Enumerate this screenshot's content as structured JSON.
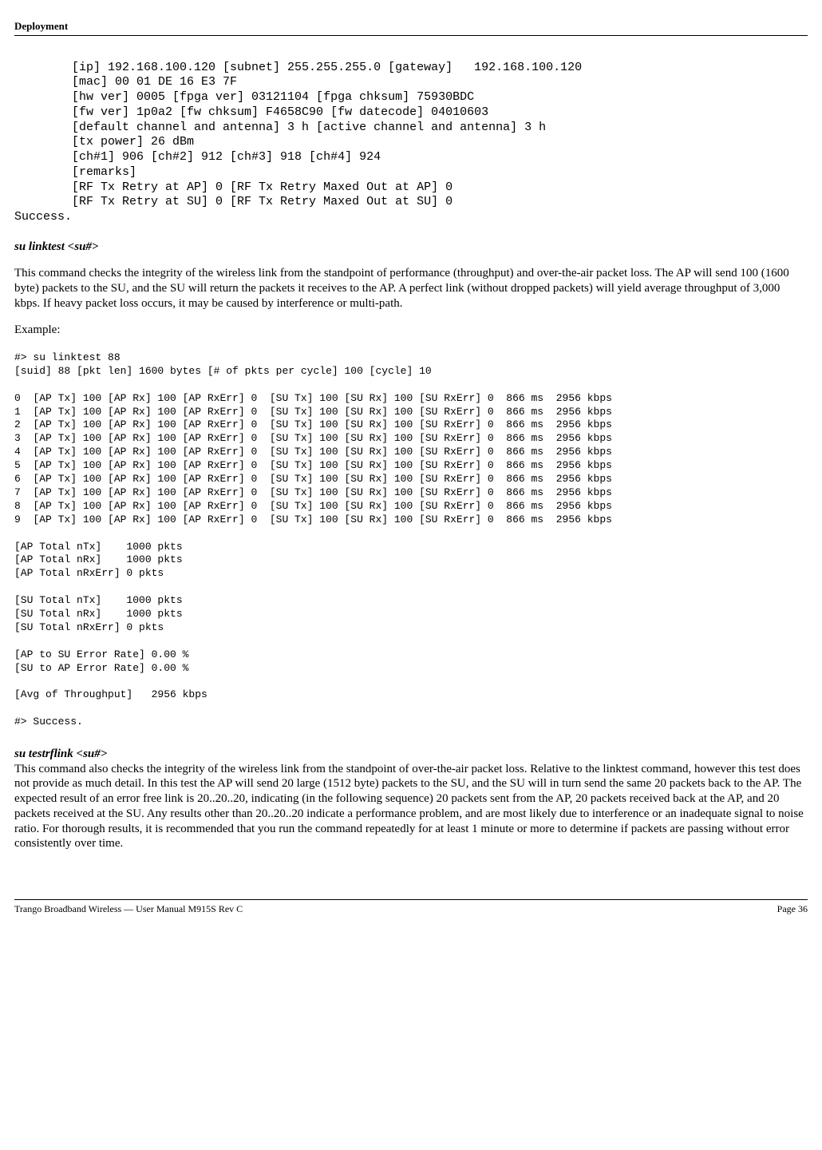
{
  "header": {
    "title": "Deployment"
  },
  "block1": {
    "l1": "        [ip] 192.168.100.120 [subnet] 255.255.255.0 [gateway]   192.168.100.120",
    "l2": "        [mac] 00 01 DE 16 E3 7F",
    "l3": "        [hw ver] 0005 [fpga ver] 03121104 [fpga chksum] 75930BDC",
    "l4": "        [fw ver] 1p0a2 [fw chksum] F4658C90 [fw datecode] 04010603",
    "l5": "        [default channel and antenna] 3 h [active channel and antenna] 3 h",
    "l6": "        [tx power] 26 dBm",
    "l7": "        [ch#1] 906 [ch#2] 912 [ch#3] 918 [ch#4] 924",
    "l8": "        [remarks]",
    "l9": "        [RF Tx Retry at AP] 0 [RF Tx Retry Maxed Out at AP] 0",
    "l10": "        [RF Tx Retry at SU] 0 [RF Tx Retry Maxed Out at SU] 0",
    "l11": "Success."
  },
  "section1": {
    "heading": "su linktest  <su#>",
    "para": "This command checks the integrity of the wireless link from the standpoint of performance (throughput) and over-the-air packet loss.  The AP will send 100 (1600 byte) packets to the SU, and the SU will return the packets it receives to the AP.  A perfect link (without dropped packets) will yield average throughput of 3,000 kbps.  If heavy packet loss occurs, it may be caused by interference or multi-path.",
    "example_label": "Example:"
  },
  "block2": {
    "l1": "#> su linktest 88",
    "l2": "[suid] 88 [pkt len] 1600 bytes [# of pkts per cycle] 100 [cycle] 10",
    "l3": "",
    "l4": "0  [AP Tx] 100 [AP Rx] 100 [AP RxErr] 0  [SU Tx] 100 [SU Rx] 100 [SU RxErr] 0  866 ms  2956 kbps",
    "l5": "1  [AP Tx] 100 [AP Rx] 100 [AP RxErr] 0  [SU Tx] 100 [SU Rx] 100 [SU RxErr] 0  866 ms  2956 kbps",
    "l6": "2  [AP Tx] 100 [AP Rx] 100 [AP RxErr] 0  [SU Tx] 100 [SU Rx] 100 [SU RxErr] 0  866 ms  2956 kbps",
    "l7": "3  [AP Tx] 100 [AP Rx] 100 [AP RxErr] 0  [SU Tx] 100 [SU Rx] 100 [SU RxErr] 0  866 ms  2956 kbps",
    "l8": "4  [AP Tx] 100 [AP Rx] 100 [AP RxErr] 0  [SU Tx] 100 [SU Rx] 100 [SU RxErr] 0  866 ms  2956 kbps",
    "l9": "5  [AP Tx] 100 [AP Rx] 100 [AP RxErr] 0  [SU Tx] 100 [SU Rx] 100 [SU RxErr] 0  866 ms  2956 kbps",
    "l10": "6  [AP Tx] 100 [AP Rx] 100 [AP RxErr] 0  [SU Tx] 100 [SU Rx] 100 [SU RxErr] 0  866 ms  2956 kbps",
    "l11": "7  [AP Tx] 100 [AP Rx] 100 [AP RxErr] 0  [SU Tx] 100 [SU Rx] 100 [SU RxErr] 0  866 ms  2956 kbps",
    "l12": "8  [AP Tx] 100 [AP Rx] 100 [AP RxErr] 0  [SU Tx] 100 [SU Rx] 100 [SU RxErr] 0  866 ms  2956 kbps",
    "l13": "9  [AP Tx] 100 [AP Rx] 100 [AP RxErr] 0  [SU Tx] 100 [SU Rx] 100 [SU RxErr] 0  866 ms  2956 kbps",
    "l14": "",
    "l15": "[AP Total nTx]    1000 pkts",
    "l16": "[AP Total nRx]    1000 pkts",
    "l17": "[AP Total nRxErr] 0 pkts",
    "l18": "",
    "l19": "[SU Total nTx]    1000 pkts",
    "l20": "[SU Total nRx]    1000 pkts",
    "l21": "[SU Total nRxErr] 0 pkts",
    "l22": "",
    "l23": "[AP to SU Error Rate] 0.00 %",
    "l24": "[SU to AP Error Rate] 0.00 %",
    "l25": "",
    "l26": "[Avg of Throughput]   2956 kbps",
    "l27": "",
    "l28": "#> Success."
  },
  "section2": {
    "heading": "su testrflink <su#>",
    "para": "This command also checks the integrity of the wireless link from the standpoint of over-the-air packet loss.  Relative to the linktest command, however this test does not provide as much detail.  In this test the AP will send 20 large (1512 byte) packets to the SU, and the SU will in turn send the same 20 packets back to the AP.  The expected result of an error free link is 20..20..20, indicating (in the following sequence) 20 packets sent from the AP, 20 packets received back at the AP, and 20 packets received at the SU.  Any results other than 20..20..20 indicate a performance problem, and are most likely due to interference or an inadequate signal to noise ratio.  For thorough results, it is recommended that you run the command repeatedly for at least 1 minute or more to determine if packets are passing without error consistently over time."
  },
  "footer": {
    "left": "Trango Broadband Wireless — User Manual M915S Rev C",
    "right": "Page 36"
  }
}
